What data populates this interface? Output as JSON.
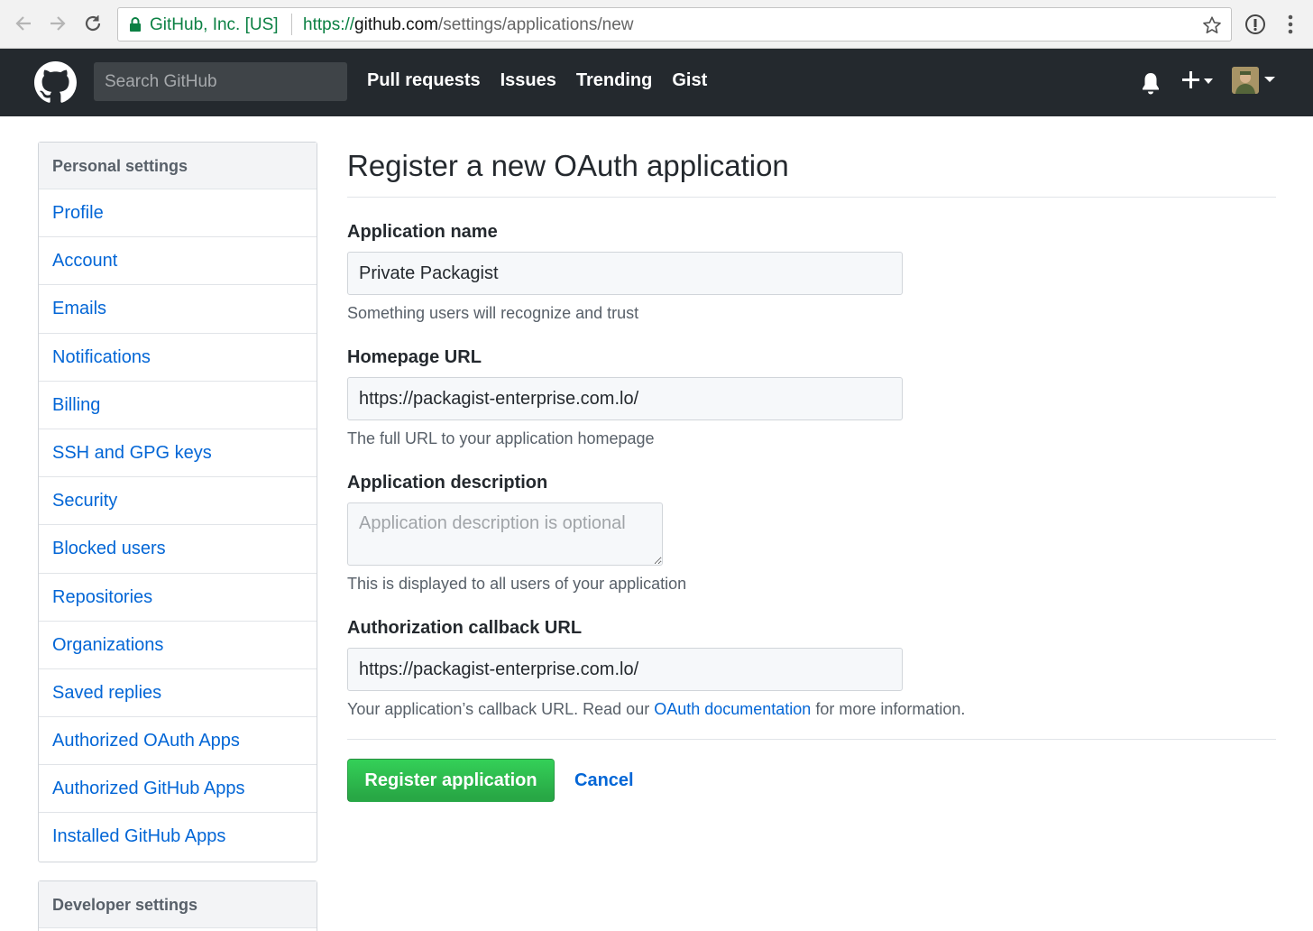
{
  "browser": {
    "security_label": "GitHub, Inc. [US]",
    "url_scheme": "https://",
    "url_host": "github.com",
    "url_path": "/settings/applications/new",
    "icons": [
      "back-icon",
      "forward-icon",
      "reload-icon",
      "lock-icon",
      "bookmark-star-icon",
      "extension-icon",
      "menu-kebab-icon"
    ]
  },
  "header": {
    "search_placeholder": "Search GitHub",
    "nav": {
      "pull_requests": "Pull requests",
      "issues": "Issues",
      "trending": "Trending",
      "gist": "Gist"
    },
    "icons": [
      "github-logo-icon",
      "notifications-bell-icon",
      "create-new-plus-icon",
      "user-avatar"
    ]
  },
  "sidebar": {
    "heading": "Personal settings",
    "items": [
      {
        "label": "Profile"
      },
      {
        "label": "Account"
      },
      {
        "label": "Emails"
      },
      {
        "label": "Notifications"
      },
      {
        "label": "Billing"
      },
      {
        "label": "SSH and GPG keys"
      },
      {
        "label": "Security"
      },
      {
        "label": "Blocked users"
      },
      {
        "label": "Repositories"
      },
      {
        "label": "Organizations"
      },
      {
        "label": "Saved replies"
      },
      {
        "label": "Authorized OAuth Apps"
      },
      {
        "label": "Authorized GitHub Apps"
      },
      {
        "label": "Installed GitHub Apps"
      }
    ],
    "developer_heading": "Developer settings"
  },
  "form": {
    "title": "Register a new OAuth application",
    "app_name": {
      "label": "Application name",
      "value": "Private Packagist",
      "note": "Something users will recognize and trust"
    },
    "homepage": {
      "label": "Homepage URL",
      "value": "https://packagist-enterprise.com.lo/",
      "note": "The full URL to your application homepage"
    },
    "description": {
      "label": "Application description",
      "placeholder": "Application description is optional",
      "note": "This is displayed to all users of your application"
    },
    "callback": {
      "label": "Authorization callback URL",
      "value": "https://packagist-enterprise.com.lo/",
      "note_before": "Your application’s callback URL. Read our ",
      "note_link": "OAuth documentation",
      "note_after": " for more information."
    },
    "submit_label": "Register application",
    "cancel_label": "Cancel"
  },
  "colors": {
    "header_bg": "#24292e",
    "link": "#0366d6",
    "primary_button": "#28a745",
    "secure_green": "#0b8043"
  }
}
